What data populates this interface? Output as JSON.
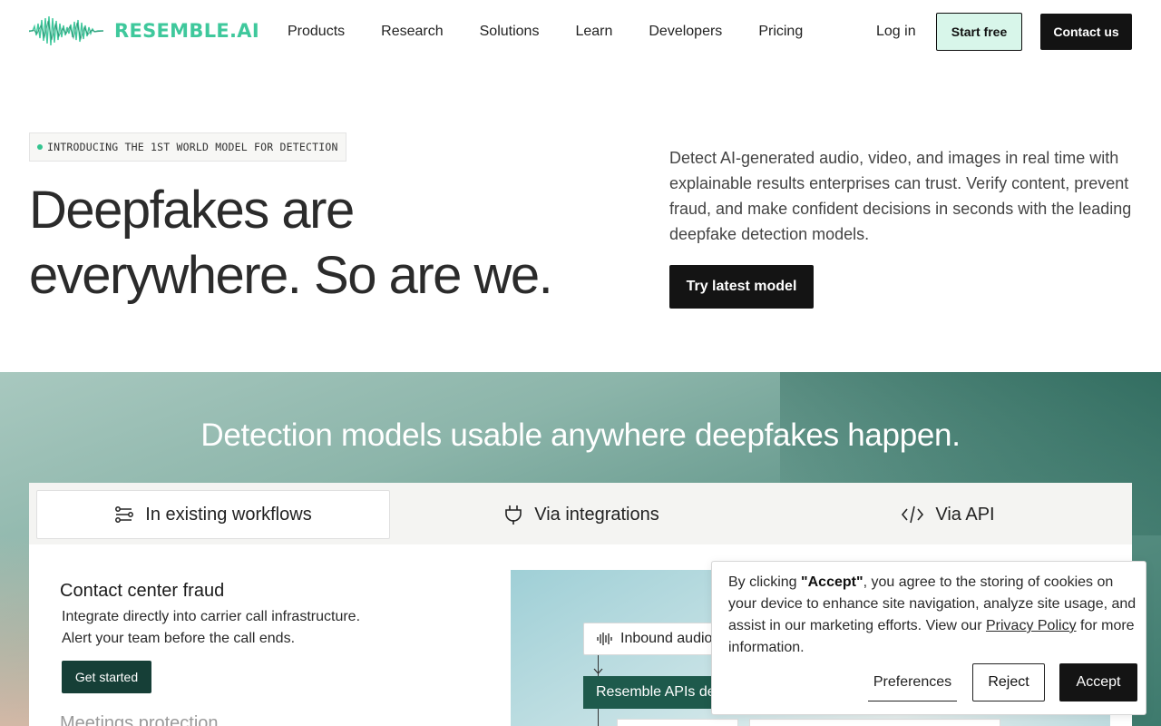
{
  "brand": {
    "name": "RESEMBLE.AI",
    "accent": "#3fc89c"
  },
  "nav": {
    "items": [
      "Products",
      "Research",
      "Solutions",
      "Learn",
      "Developers",
      "Pricing"
    ],
    "login": "Log in",
    "start_free": "Start free",
    "contact": "Contact us"
  },
  "hero": {
    "badge": "INTRODUCING THE 1ST WORLD MODEL FOR DETECTION",
    "title_line1": "Deepfakes are",
    "title_line2": "everywhere. So are we.",
    "description": "Detect AI-generated audio, video, and images in real time with explainable results enterprises can trust. Verify content, prevent fraud, and make confident decisions in seconds with the leading deepfake detection models.",
    "cta": "Try latest model"
  },
  "detection": {
    "title": "Detection models usable anywhere deepfakes happen.",
    "tabs": [
      {
        "label": "In existing workflows",
        "icon": "workflow-icon",
        "active": true
      },
      {
        "label": "Via integrations",
        "icon": "plug-icon",
        "active": false
      },
      {
        "label": "Via API",
        "icon": "code-icon",
        "active": false
      }
    ],
    "case_title": "Contact center fraud",
    "case_desc_line1": "Integrate directly into carrier call infrastructure.",
    "case_desc_line2": "Alert your team before the call ends.",
    "case_button": "Get started",
    "case2_title": "Meetings protection",
    "diagram": {
      "inbound": "Inbound audio",
      "resemble": "Resemble APIs detect"
    }
  },
  "cookie": {
    "text_prefix": "By clicking ",
    "accept_quote": "\"Accept\"",
    "text_mid": ", you agree to the storing of cookies on your device to enhance site navigation, analyze site usage, and assist in our marketing efforts. View our ",
    "privacy_link": "Privacy Policy",
    "text_suffix": " for more information.",
    "preferences": "Preferences",
    "reject": "Reject",
    "accept": "Accept"
  }
}
